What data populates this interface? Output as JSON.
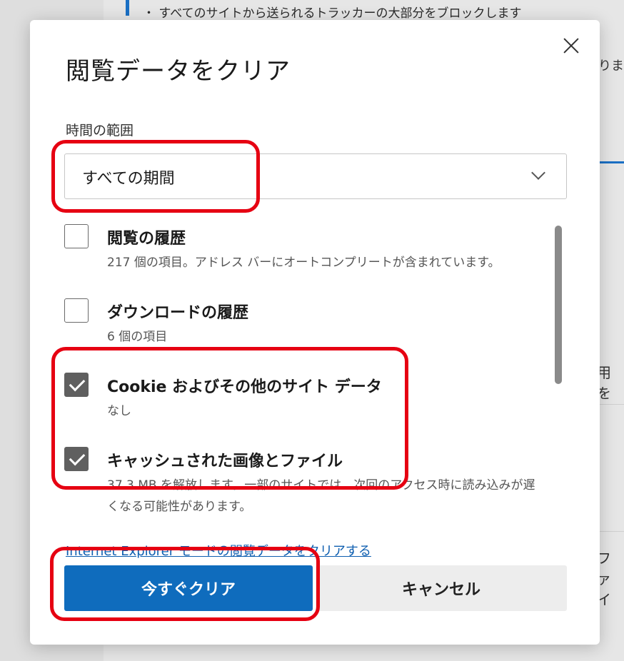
{
  "background": {
    "top_text": "・ すべてのサイトから送られるトラッカーの大部分をブロックします",
    "right_text_1": "りま",
    "right_text_2": "用を",
    "right_text_3": "ファイ"
  },
  "dialog": {
    "title": "閲覧データをクリア",
    "time_range": {
      "label": "時間の範囲",
      "selected": "すべての期間"
    },
    "items": [
      {
        "label": "閲覧の履歴",
        "description": "217 個の項目。アドレス バーにオートコンプリートが含まれています。",
        "checked": false
      },
      {
        "label": "ダウンロードの履歴",
        "description": "6 個の項目",
        "checked": false
      },
      {
        "label": "Cookie およびその他のサイト データ",
        "description": "なし",
        "checked": true
      },
      {
        "label": "キャッシュされた画像とファイル",
        "description": "37.3 MB を解放します。一部のサイトでは、次回のアクセス時に読み込みが遅くなる可能性があります。",
        "checked": true
      }
    ],
    "ie_link": "Internet Explorer モードの閲覧データをクリアする",
    "clear_button": "今すぐクリア",
    "cancel_button": "キャンセル"
  },
  "colors": {
    "primary": "#0f6cbd",
    "highlight": "#e60012",
    "checkbox_checked": "#5f5f5f"
  }
}
